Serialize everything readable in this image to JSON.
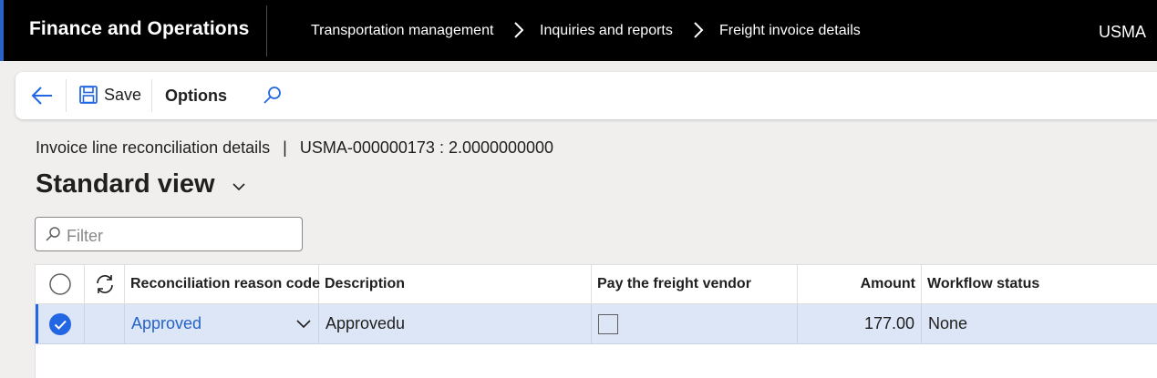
{
  "app": {
    "title": "Finance and Operations",
    "company": "USMA",
    "accent_color": "#2a63c4"
  },
  "breadcrumb": [
    {
      "label": "Transportation management"
    },
    {
      "label": "Inquiries and reports"
    },
    {
      "label": "Freight invoice details"
    }
  ],
  "actionpane": {
    "back_icon": "back-arrow-icon",
    "save_label": "Save",
    "options_label": "Options",
    "search_icon": "search-icon"
  },
  "page": {
    "caption_form": "Invoice line reconciliation details",
    "caption_separator": "|",
    "caption_record": "USMA-000000173 : 2.0000000000",
    "view_name": "Standard view"
  },
  "filter": {
    "placeholder": "Filter",
    "value": ""
  },
  "grid": {
    "columns": [
      {
        "key": "select",
        "label": ""
      },
      {
        "key": "refresh",
        "label": ""
      },
      {
        "key": "reason",
        "label": "Reconciliation reason code"
      },
      {
        "key": "description",
        "label": "Description"
      },
      {
        "key": "pay",
        "label": "Pay the freight vendor"
      },
      {
        "key": "amount",
        "label": "Amount"
      },
      {
        "key": "workflow",
        "label": "Workflow status"
      }
    ],
    "rows": [
      {
        "selected": true,
        "reason": "Approved",
        "description": "Approvedu",
        "pay": false,
        "amount": "177.00",
        "workflow": "None"
      }
    ],
    "selection_color": "#dce6f7"
  }
}
